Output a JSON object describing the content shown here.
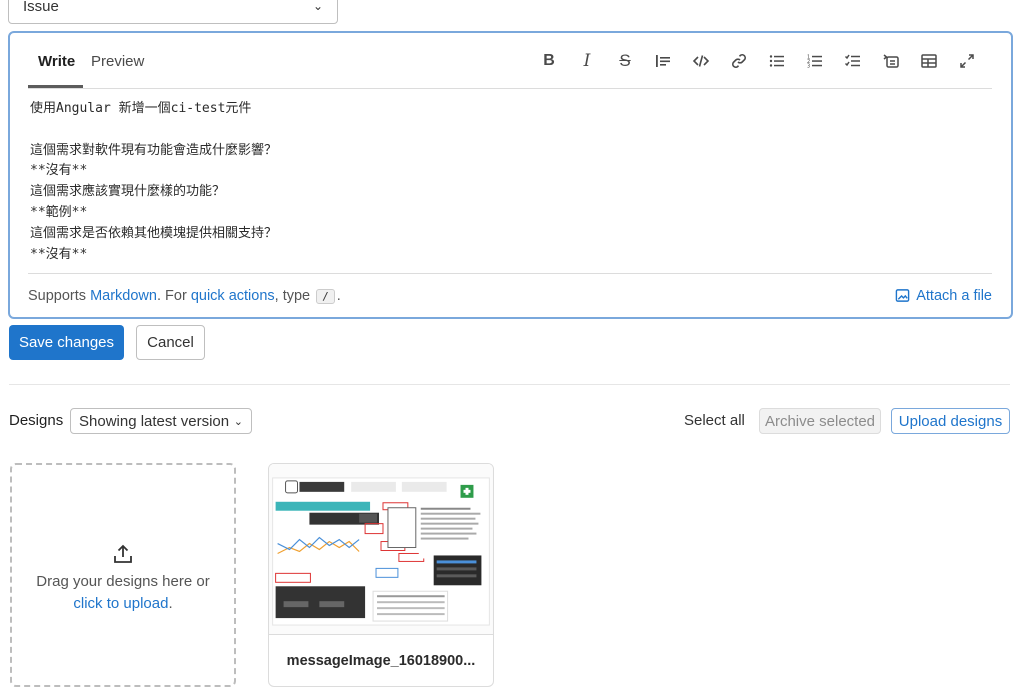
{
  "issue_type": {
    "selected": "Issue"
  },
  "editor": {
    "tabs": {
      "write": "Write",
      "preview": "Preview"
    },
    "toolbar": [
      "bold-icon",
      "italic-icon",
      "strikethrough-icon",
      "quote-icon",
      "code-icon",
      "link-icon",
      "bullet-list-icon",
      "numbered-list-icon",
      "task-list-icon",
      "collapsible-icon",
      "table-icon",
      "fullscreen-icon"
    ],
    "content": "使用Angular 新增一個ci-test元件\n\n這個需求對軟件現有功能會造成什麼影響？\n**沒有**\n這個需求應該實現什麼樣的功能？\n**範例**\n這個需求是否依賴其他模塊提供相關支持？\n**沒有**",
    "footer": {
      "prefix": "Supports ",
      "markdown": "Markdown",
      "middle": ". For ",
      "quick_actions": "quick actions",
      "type_text": ", type",
      "kbd": "/",
      "suffix": ".",
      "attach": "Attach a file"
    }
  },
  "actions": {
    "save": "Save changes",
    "cancel": "Cancel"
  },
  "designs": {
    "label": "Designs",
    "version": "Showing latest version",
    "select_all": "Select all",
    "archive": "Archive selected",
    "upload": "Upload designs",
    "dropzone": {
      "line1": "Drag your designs here or",
      "link": "click to upload",
      "suffix": "."
    },
    "items": [
      {
        "name": "messageImage_16018900..."
      }
    ]
  },
  "colors": {
    "accent": "#1f75cb",
    "focus_border": "#7aa8dc",
    "text": "#303030"
  }
}
